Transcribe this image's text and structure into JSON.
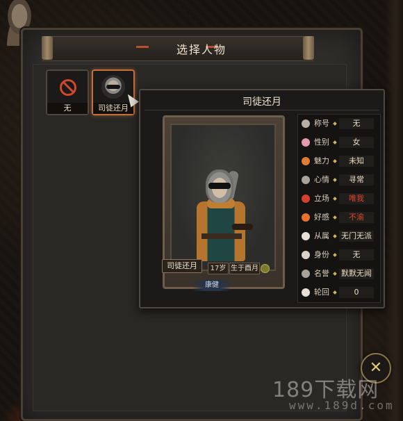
{
  "header": {
    "title": "选择人物"
  },
  "slots": [
    {
      "label": "无",
      "icon": "no-entry-icon"
    },
    {
      "label": "司徒还月",
      "icon": "character-portrait"
    }
  ],
  "profile": {
    "name": "司徒还月",
    "name_plate": "司徒还月",
    "age": "17岁",
    "birth": "生于酉月",
    "health": "康健"
  },
  "attributes": [
    {
      "label": "称号",
      "value": "无",
      "icon": "title-icon",
      "color": "#b8b0a6"
    },
    {
      "label": "性别",
      "value": "女",
      "icon": "gender-icon",
      "color": "#e59ab0"
    },
    {
      "label": "魅力",
      "value": "未知",
      "icon": "lotus-icon",
      "color": "#e07b3a"
    },
    {
      "label": "心情",
      "value": "寻常",
      "icon": "heart-icon",
      "color": "#a8a39b"
    },
    {
      "label": "立场",
      "value": "唯我",
      "icon": "eye-icon",
      "color": "#d2402f",
      "value_color": "#e0432f"
    },
    {
      "label": "好感",
      "value": "不渝",
      "icon": "favor-heart-icon",
      "color": "#e8722d",
      "value_color": "#e0432f"
    },
    {
      "label": "从属",
      "value": "无门无派",
      "icon": "faction-icon",
      "color": "#e6e0d6"
    },
    {
      "label": "身份",
      "value": "无",
      "icon": "identity-icon",
      "color": "#d9d3c9"
    },
    {
      "label": "名誉",
      "value": "默默无闻",
      "icon": "fame-icon",
      "color": "#a8a39b"
    },
    {
      "label": "轮回",
      "value": "0",
      "icon": "cycle-icon",
      "color": "#e6e0d6"
    }
  ],
  "watermark": {
    "main": "189下载网",
    "sub": "www.189d.com"
  },
  "corner_button": {
    "icon": "close-x-icon"
  }
}
